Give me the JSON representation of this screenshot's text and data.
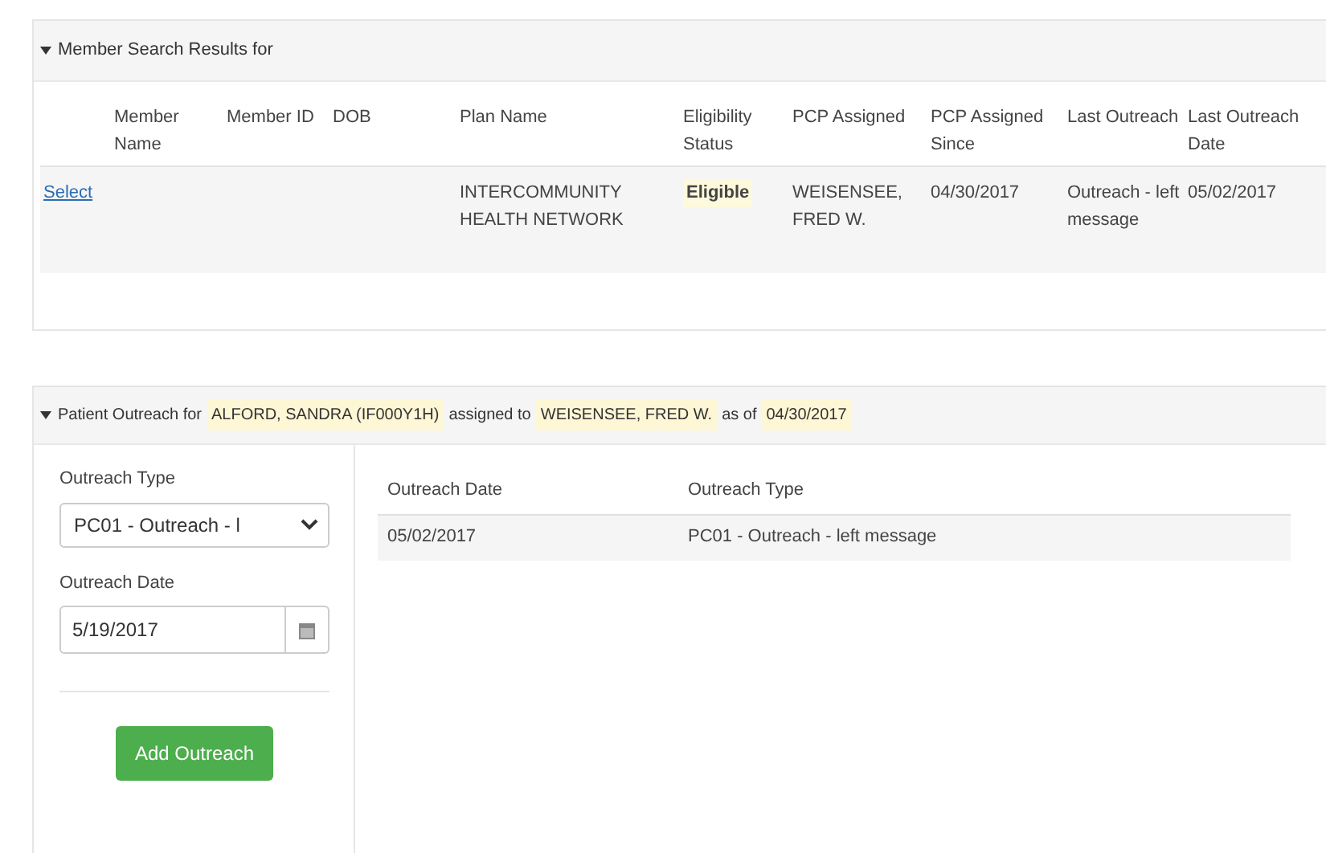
{
  "search_results": {
    "title": "Member Search Results for",
    "columns": [
      "Member Name",
      "Member ID",
      "DOB",
      "Plan Name",
      "Eligibility Status",
      "PCP Assigned",
      "PCP Assigned Since",
      "Last Outreach",
      "Last Outreach Date"
    ],
    "rows": [
      {
        "action": "Select",
        "plan_name": "INTERCOMMUNITY HEALTH NETWORK",
        "eligibility_status": "Eligible",
        "eligible": true,
        "pcp_assigned": "WEISENSEE, FRED W.",
        "pcp_assigned_since": "04/30/2017",
        "last_outreach": "Outreach - left message",
        "last_outreach_date": "05/02/2017"
      }
    ]
  },
  "patient_outreach": {
    "title_parts": [
      {
        "text": "Patient Outreach for",
        "highlighted": false
      },
      {
        "text": "ALFORD, SANDRA (IF000Y1H)",
        "highlighted": true
      },
      {
        "text": "assigned to",
        "highlighted": false
      },
      {
        "text": "WEISENSEE, FRED W.",
        "highlighted": true
      },
      {
        "text": "as of",
        "highlighted": false
      },
      {
        "text": "04/30/2017",
        "highlighted": true
      }
    ],
    "form": {
      "outreach_type": {
        "label": "Outreach Type",
        "value": "PC01 - Outreach - l"
      },
      "outreach_date": {
        "label": "Outreach Date",
        "value": "5/19/2017"
      },
      "button": "Add Outreach"
    },
    "history": {
      "columns": [
        "Outreach Date",
        "Outreach Type"
      ],
      "rows": [
        [
          "05/02/2017",
          "PC01 - Outreach - left message"
        ]
      ]
    }
  }
}
